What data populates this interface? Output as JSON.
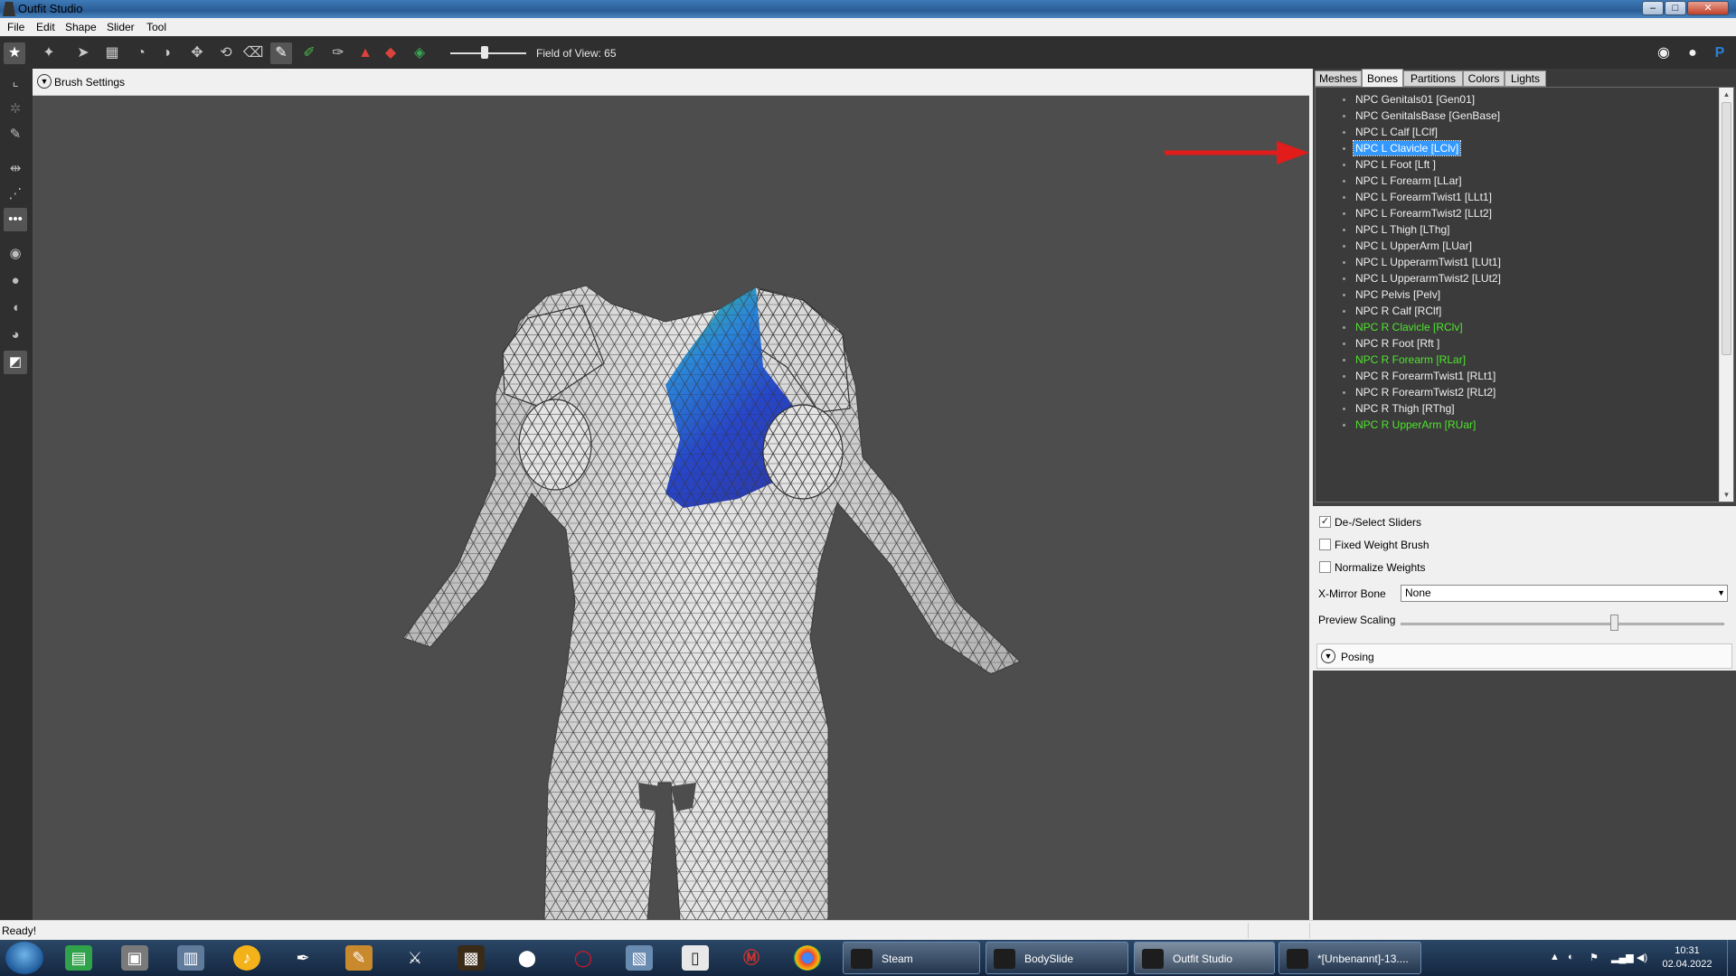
{
  "window": {
    "title": "Outfit Studio",
    "minimize": "–",
    "maximize": "□",
    "close": "✕"
  },
  "menu": [
    "File",
    "Edit",
    "Shape",
    "Slider",
    "Tool"
  ],
  "toolbar": {
    "fov_label": "Field of View: 65",
    "fov_value": 65
  },
  "brush_settings": {
    "label": "Brush Settings"
  },
  "tabs": [
    "Meshes",
    "Bones",
    "Partitions",
    "Colors",
    "Lights"
  ],
  "active_tab": "Bones",
  "bones": [
    {
      "label": "NPC Genitals01 [Gen01]",
      "state": "normal"
    },
    {
      "label": "NPC GenitalsBase [GenBase]",
      "state": "normal"
    },
    {
      "label": "NPC L Calf [LClf]",
      "state": "normal"
    },
    {
      "label": "NPC L Clavicle [LClv]",
      "state": "selected"
    },
    {
      "label": "NPC L Foot [Lft ]",
      "state": "normal"
    },
    {
      "label": "NPC L Forearm [LLar]",
      "state": "normal"
    },
    {
      "label": "NPC L ForearmTwist1 [LLt1]",
      "state": "normal"
    },
    {
      "label": "NPC L ForearmTwist2 [LLt2]",
      "state": "normal"
    },
    {
      "label": "NPC L Thigh [LThg]",
      "state": "normal"
    },
    {
      "label": "NPC L UpperArm [LUar]",
      "state": "normal"
    },
    {
      "label": "NPC L UpperarmTwist1 [LUt1]",
      "state": "normal"
    },
    {
      "label": "NPC L UpperarmTwist2 [LUt2]",
      "state": "normal"
    },
    {
      "label": "NPC Pelvis [Pelv]",
      "state": "normal"
    },
    {
      "label": "NPC R Calf [RClf]",
      "state": "normal"
    },
    {
      "label": "NPC R Clavicle [RClv]",
      "state": "highlight"
    },
    {
      "label": "NPC R Foot [Rft ]",
      "state": "normal"
    },
    {
      "label": "NPC R Forearm [RLar]",
      "state": "highlight"
    },
    {
      "label": "NPC R ForearmTwist1 [RLt1]",
      "state": "normal"
    },
    {
      "label": "NPC R ForearmTwist2 [RLt2]",
      "state": "normal"
    },
    {
      "label": "NPC R Thigh [RThg]",
      "state": "normal"
    },
    {
      "label": "NPC R UpperArm [RUar]",
      "state": "highlight"
    }
  ],
  "options": {
    "deselect_sliders": {
      "label": "De-/Select Sliders",
      "checked": true
    },
    "fixed_weight_brush": {
      "label": "Fixed Weight Brush",
      "checked": false
    },
    "normalize_weights": {
      "label": "Normalize Weights",
      "checked": false
    },
    "x_mirror_bone": {
      "label": "X-Mirror Bone",
      "value": "None"
    },
    "preview_scaling": {
      "label": "Preview Scaling",
      "value": 0.66
    }
  },
  "posing": {
    "label": "Posing"
  },
  "status": {
    "text": "Ready!"
  },
  "taskbar": {
    "tasks": [
      {
        "label": "Steam",
        "active": false
      },
      {
        "label": "BodySlide",
        "active": false
      },
      {
        "label": "Outfit Studio",
        "active": true
      },
      {
        "label": "*[Unbenannt]-13....",
        "active": false
      }
    ],
    "clock_time": "10:31",
    "clock_date": "02.04.2022"
  },
  "colors": {
    "accent_selection": "#3399ff",
    "bone_highlight": "#4ee52d",
    "weight_paint_blue": "#1a3cd6",
    "weight_paint_green": "#2fc36a",
    "annotation_arrow": "#e21b1b",
    "viewport_bg": "#4d4d4d"
  }
}
